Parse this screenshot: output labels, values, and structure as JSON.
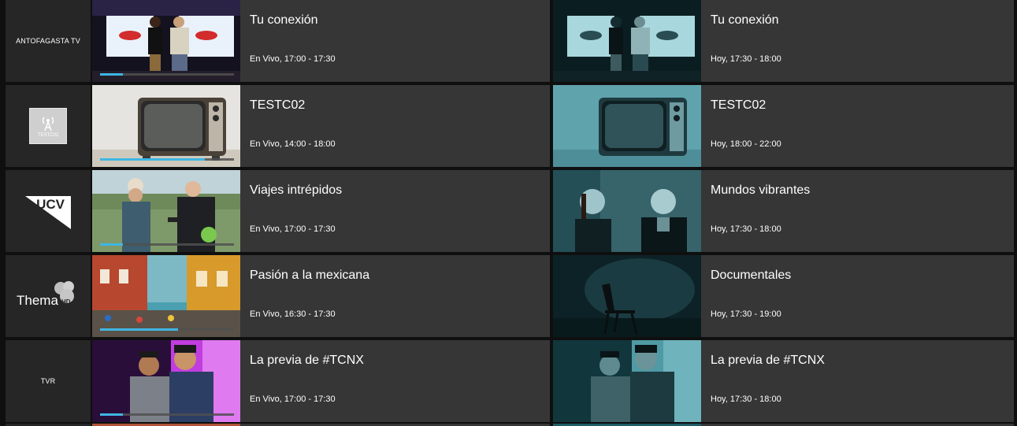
{
  "colors": {
    "background": "#0f0f0f",
    "channel_bg": "#262626",
    "program_bg": "#363636",
    "progress": "#3eb6e4",
    "next_tint": "#146e7d"
  },
  "rows": [
    {
      "channel": {
        "type": "text",
        "label": "ANTOFAGASTA TV"
      },
      "now": {
        "title": "Tu conexión",
        "time": "En Vivo, 17:00 - 17:30",
        "progress": 0.17,
        "thumb": "studio-hosts-image"
      },
      "next": {
        "title": "Tu conexión",
        "time": "Hoy, 17:30 - 18:00",
        "thumb": "studio-hosts-image"
      }
    },
    {
      "channel": {
        "type": "logo",
        "label": "TESTC02",
        "icon": "broadcast-tower-icon"
      },
      "now": {
        "title": "TESTC02",
        "time": "En Vivo, 14:00 - 18:00",
        "progress": 0.78,
        "thumb": "retro-tv-image"
      },
      "next": {
        "title": "TESTC02",
        "time": "Hoy, 18:00 - 22:00",
        "thumb": "retro-tv-image"
      }
    },
    {
      "channel": {
        "type": "logo",
        "label": "UCV",
        "icon": "ucv-logo"
      },
      "now": {
        "title": "Viajes intrépidos",
        "time": "En Vivo, 17:00 - 17:30",
        "progress": 0.17,
        "thumb": "interview-outdoor-image"
      },
      "next": {
        "title": "Mundos vibrantes",
        "time": "Hoy, 17:30 - 18:00",
        "thumb": "two-presenters-image"
      }
    },
    {
      "channel": {
        "type": "logo",
        "label": "Thema",
        "badge": "HD",
        "icon": "thema-hd-logo"
      },
      "now": {
        "title": "Pasión a la mexicana",
        "time": "En Vivo, 16:30 - 17:30",
        "progress": 0.58,
        "thumb": "colonial-street-image"
      },
      "next": {
        "title": "Documentales",
        "time": "Hoy, 17:30 - 19:00",
        "thumb": "chair-spotlight-image"
      }
    },
    {
      "channel": {
        "type": "text",
        "label": "TVR"
      },
      "now": {
        "title": "La previa de #TCNX",
        "time": "En Vivo, 17:00 - 17:30",
        "progress": 0.17,
        "thumb": "hosts-purple-image"
      },
      "next": {
        "title": "La previa de #TCNX",
        "time": "Hoy, 17:30 - 18:00",
        "thumb": "hosts-purple-image"
      }
    }
  ]
}
